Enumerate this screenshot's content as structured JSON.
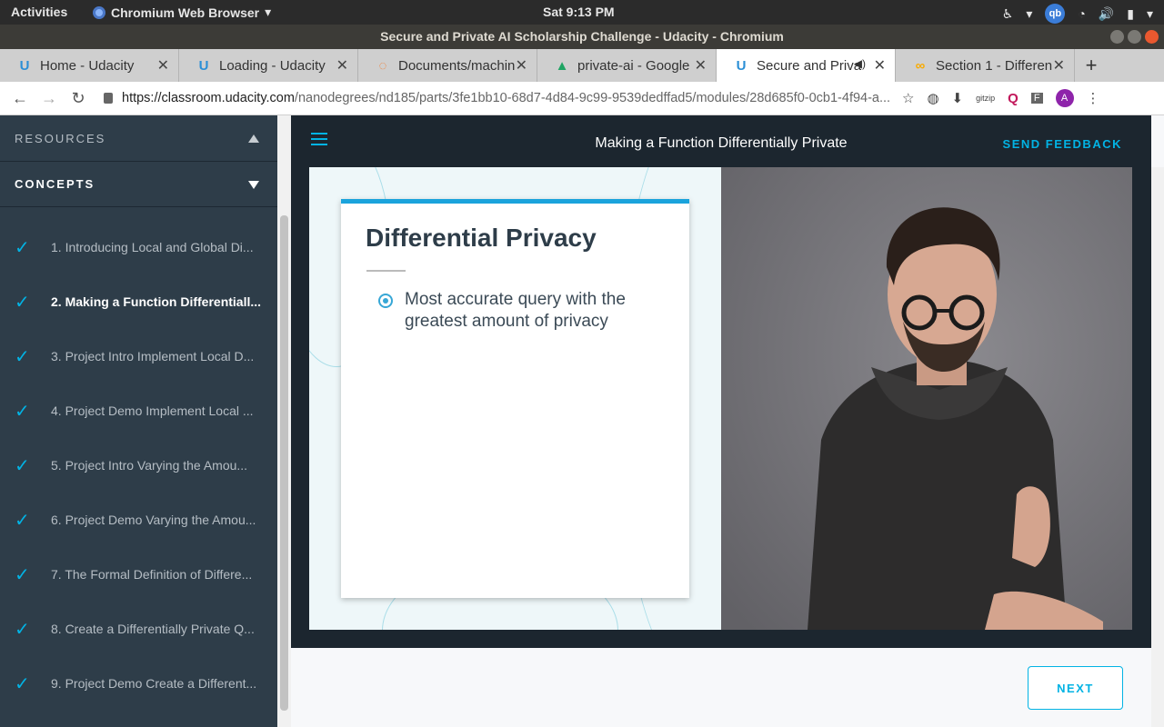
{
  "system": {
    "activities": "Activities",
    "app_name": "Chromium Web Browser",
    "clock": "Sat  9:13 PM",
    "user_badge": "qb"
  },
  "window": {
    "title": "Secure and Private AI Scholarship Challenge - Udacity - Chromium"
  },
  "tabs": [
    {
      "label": "Home - Udacity",
      "icon": "udacity-logo-icon"
    },
    {
      "label": "Loading - Udacity",
      "icon": "udacity-logo-icon"
    },
    {
      "label": "Documents/machin",
      "icon": "jupyter-icon"
    },
    {
      "label": "private-ai - Google",
      "icon": "google-drive-icon"
    },
    {
      "label": "Secure and Priva",
      "icon": "udacity-logo-icon",
      "active": true,
      "audio": true
    },
    {
      "label": "Section 1 - Differen",
      "icon": "colab-icon"
    }
  ],
  "address": {
    "host": "https://classroom.udacity.com",
    "path": "/nanodegrees/nd185/parts/3fe1bb10-68d7-4d84-9c99-9539dedffad5/modules/28d685f0-0cb1-4f94-a..."
  },
  "profile": {
    "initial": "A"
  },
  "sidebar": {
    "resources_label": "RESOURCES",
    "concepts_label": "CONCEPTS",
    "concepts": [
      {
        "label": "1. Introducing Local and Global Di...",
        "done": true
      },
      {
        "label": "2. Making a Function Differentiall...",
        "done": true,
        "current": true
      },
      {
        "label": "3. Project Intro Implement Local D...",
        "done": true
      },
      {
        "label": "4. Project Demo Implement Local ...",
        "done": true
      },
      {
        "label": "5. Project Intro Varying the Amou...",
        "done": true
      },
      {
        "label": "6. Project Demo Varying the Amou...",
        "done": true
      },
      {
        "label": "7. The Formal Definition of Differe...",
        "done": true
      },
      {
        "label": "8. Create a Differentially Private Q...",
        "done": true
      },
      {
        "label": "9. Project Demo Create a Different...",
        "done": true
      }
    ]
  },
  "page": {
    "title": "Making a Function Differentially Private",
    "feedback_label": "SEND FEEDBACK",
    "next_label": "NEXT"
  },
  "slide": {
    "heading": "Differential Privacy",
    "bullet": "Most accurate query with the greatest amount of privacy"
  },
  "colors": {
    "accent": "#02b3e4",
    "sidebar_bg": "#2e3d49",
    "header_bg": "#1c262f"
  }
}
